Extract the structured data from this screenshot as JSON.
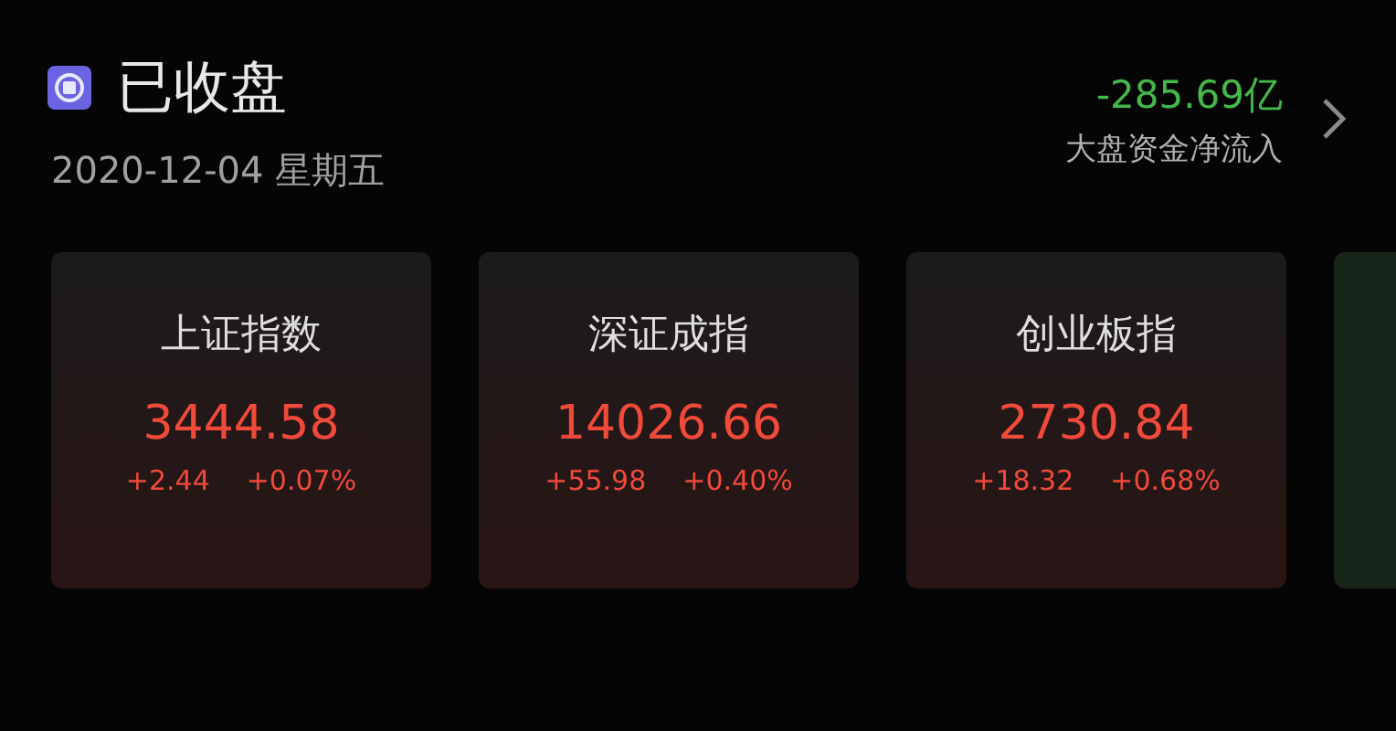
{
  "status": {
    "kind": "closed",
    "label": "已收盘",
    "date": "2020-12-04 星期五"
  },
  "net_flow": {
    "color": "#45b84a",
    "value": "-285.69亿",
    "label": "大盘资金净流入"
  },
  "cards": [
    {
      "name": "上证指数",
      "value": "3444.58",
      "change": "+2.44",
      "percent": "+0.07%",
      "color": "#f24a3a"
    },
    {
      "name": "深证成指",
      "value": "14026.66",
      "change": "+55.98",
      "percent": "+0.40%",
      "color": "#f24a3a"
    },
    {
      "name": "创业板指",
      "value": "2730.84",
      "change": "+18.32",
      "percent": "+0.68%",
      "color": "#f24a3a"
    },
    {
      "color": "#17241a"
    }
  ]
}
